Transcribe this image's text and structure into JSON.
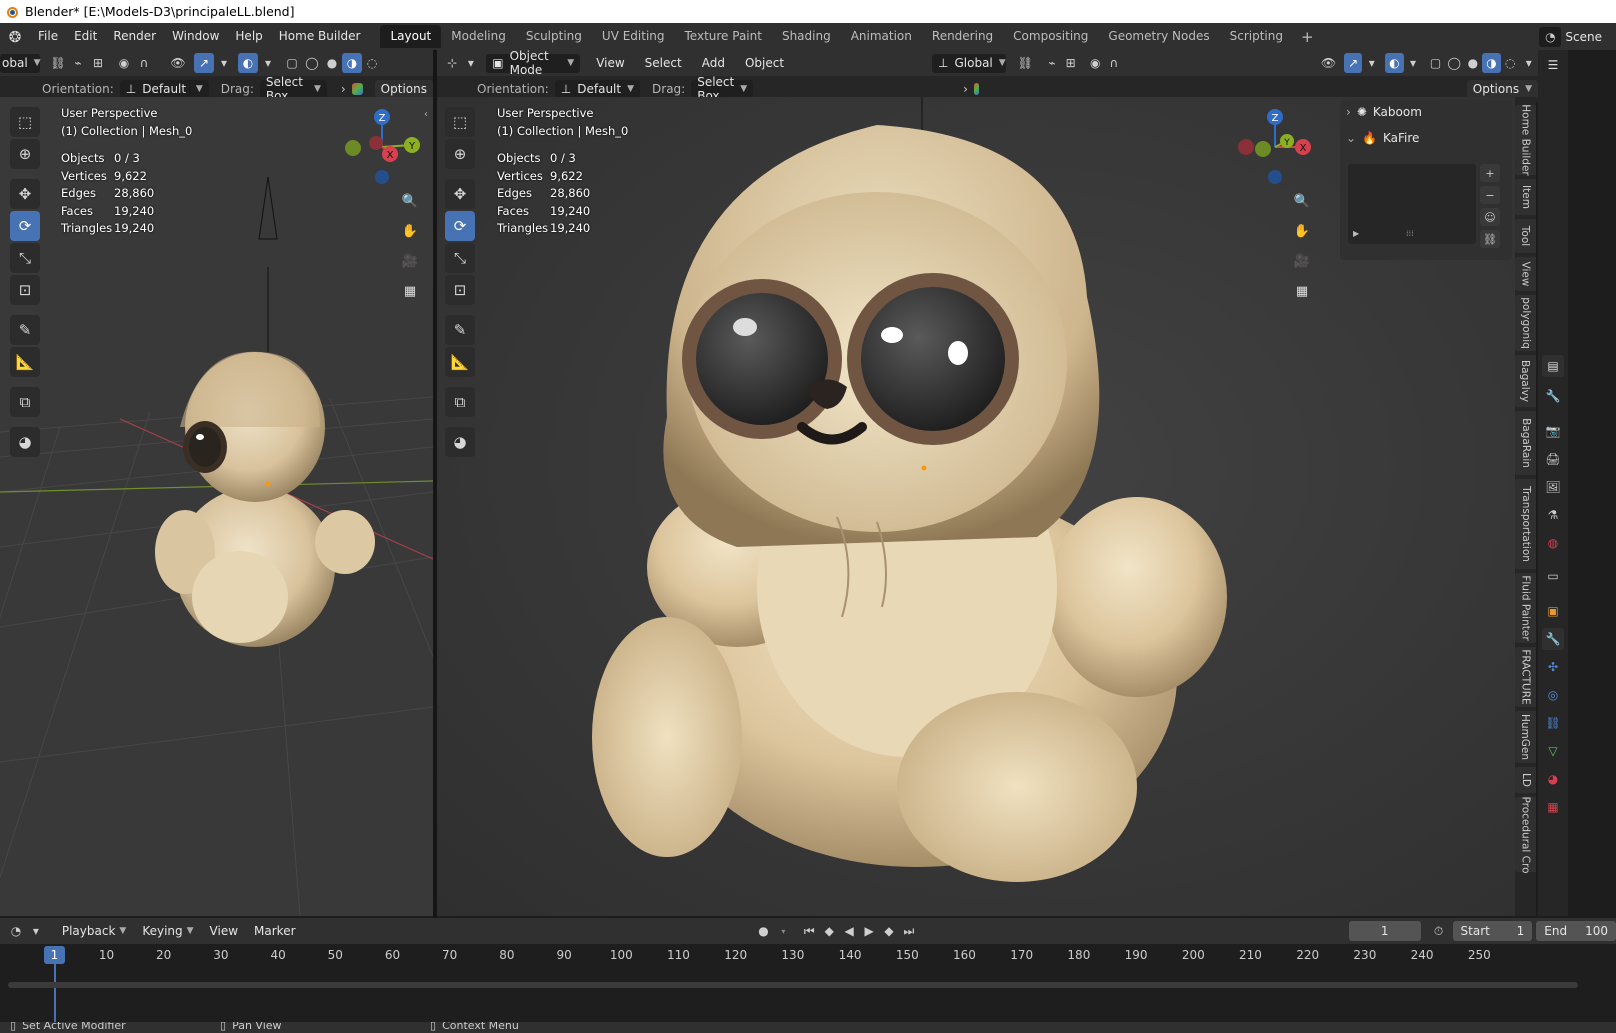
{
  "window": {
    "title": "Blender* [E:\\Models-D3\\principaleLL.blend]"
  },
  "menu": [
    "File",
    "Edit",
    "Render",
    "Window",
    "Help",
    "Home Builder"
  ],
  "workspaces": [
    "Layout",
    "Modeling",
    "Sculpting",
    "UV Editing",
    "Texture Paint",
    "Shading",
    "Animation",
    "Rendering",
    "Compositing",
    "Geometry Nodes",
    "Scripting"
  ],
  "active_workspace": "Layout",
  "scene_label": "Scene",
  "left_vp": {
    "header": {
      "transform": "obal"
    },
    "tool_header": {
      "orientation_label": "Orientation:",
      "orientation_value": "Default",
      "drag_label": "Drag:",
      "drag_value": "Select Box",
      "options": "Options"
    },
    "perspective": "User Perspective",
    "collection": "(1) Collection | Mesh_0",
    "stats": [
      {
        "k": "Objects",
        "v": "0 / 3"
      },
      {
        "k": "Vertices",
        "v": "9,622"
      },
      {
        "k": "Edges",
        "v": "28,860"
      },
      {
        "k": "Faces",
        "v": "19,240"
      },
      {
        "k": "Triangles",
        "v": "19,240"
      }
    ]
  },
  "main_vp": {
    "header": {
      "mode": "Object Mode",
      "view": "View",
      "select": "Select",
      "add": "Add",
      "object": "Object",
      "transform": "Global",
      "options": "Options"
    },
    "tool_header": {
      "orientation_label": "Orientation:",
      "orientation_value": "Default",
      "drag_label": "Drag:",
      "drag_value": "Select Box"
    },
    "perspective": "User Perspective",
    "collection": "(1) Collection | Mesh_0",
    "stats": [
      {
        "k": "Objects",
        "v": "0 / 3"
      },
      {
        "k": "Vertices",
        "v": "9,622"
      },
      {
        "k": "Edges",
        "v": "28,860"
      },
      {
        "k": "Faces",
        "v": "19,240"
      },
      {
        "k": "Triangles",
        "v": "19,240"
      }
    ]
  },
  "gizmo_axes": {
    "z": "Z",
    "x": "X",
    "y": "Y"
  },
  "npanel": {
    "items": [
      "Kaboom",
      "KaFire"
    ]
  },
  "sidebar_tabs": [
    "Home Builder",
    "Item",
    "Tool",
    "View",
    "polygoniq",
    "Bagalvy",
    "BagaRain",
    "Transportation",
    "Fluid Painter",
    "FRACTURE",
    "HumGen",
    "LD",
    "Procedural Cro"
  ],
  "timeline": {
    "playback": "Playback",
    "keying": "Keying",
    "view": "View",
    "marker": "Marker",
    "current_frame": "1",
    "start_label": "Start",
    "start": "1",
    "end_label": "End",
    "end": "100",
    "ticks": [
      "10",
      "20",
      "30",
      "40",
      "50",
      "60",
      "70",
      "80",
      "90",
      "100",
      "110",
      "120",
      "130",
      "140",
      "150",
      "160",
      "170",
      "180",
      "190",
      "200",
      "210",
      "220",
      "230",
      "240",
      "250"
    ]
  },
  "status": {
    "left": "Set Active Modifier",
    "mid": "Pan View",
    "right": "Context Menu"
  },
  "colors": {
    "accent": "#4772b3",
    "x_axis": "#d6414f",
    "y_axis": "#8bb021",
    "z_axis": "#2f6dc7"
  }
}
